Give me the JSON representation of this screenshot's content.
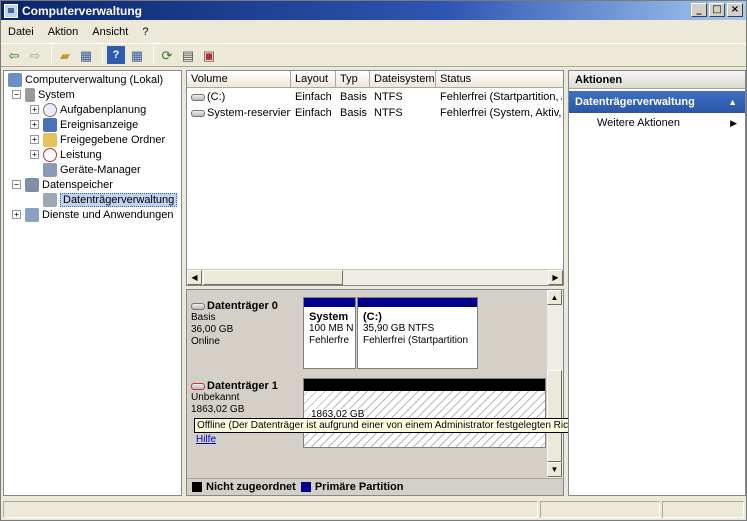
{
  "window": {
    "title": "Computerverwaltung",
    "minimize": "_",
    "maximize": "□",
    "close": "×"
  },
  "menu": [
    "Datei",
    "Aktion",
    "Ansicht",
    "?"
  ],
  "tree": {
    "root": "Computerverwaltung (Lokal)",
    "system": "System",
    "aufgabenplanung": "Aufgabenplanung",
    "ereignisanzeige": "Ereignisanzeige",
    "freigegebene": "Freigegebene Ordner",
    "leistung": "Leistung",
    "geraete": "Geräte-Manager",
    "datenspeicher": "Datenspeicher",
    "datentraeger": "Datenträgerverwaltung",
    "dienste": "Dienste und Anwendungen"
  },
  "volumes": {
    "columns": [
      "Volume",
      "Layout",
      "Typ",
      "Dateisystem",
      "Status"
    ],
    "rows": [
      [
        "(C:)",
        "Einfach",
        "Basis",
        "NTFS",
        "Fehlerfrei (Startpartition, A"
      ],
      [
        "System-reserviert",
        "Einfach",
        "Basis",
        "NTFS",
        "Fehlerfrei (System, Aktiv, P"
      ]
    ]
  },
  "disk0": {
    "name": "Datenträger 0",
    "type": "Basis",
    "size": "36,00 GB",
    "state": "Online",
    "p1_title": "System",
    "p1_size": "100 MB N",
    "p1_status": "Fehlerfre",
    "p2_title": "(C:)",
    "p2_size": "35,90 GB NTFS",
    "p2_status": "Fehlerfrei (Startpartition"
  },
  "disk1": {
    "name": "Datenträger 1",
    "type": "Unbekannt",
    "size": "1863,02 GB",
    "part_size": "1863,02 GB",
    "tooltip": "Offline (Der Datenträger ist aufgrund einer von einem Administrator festgelegten Richtlinie offline.)",
    "help": "Hilfe"
  },
  "legend": {
    "unallocated": "Nicht zugeordnet",
    "primary": "Primäre Partition"
  },
  "actions": {
    "header": "Aktionen",
    "section": "Datenträgerverwaltung",
    "more": "Weitere Aktionen"
  },
  "colors": {
    "primary": "#00008b",
    "unallocated": "#000000"
  }
}
